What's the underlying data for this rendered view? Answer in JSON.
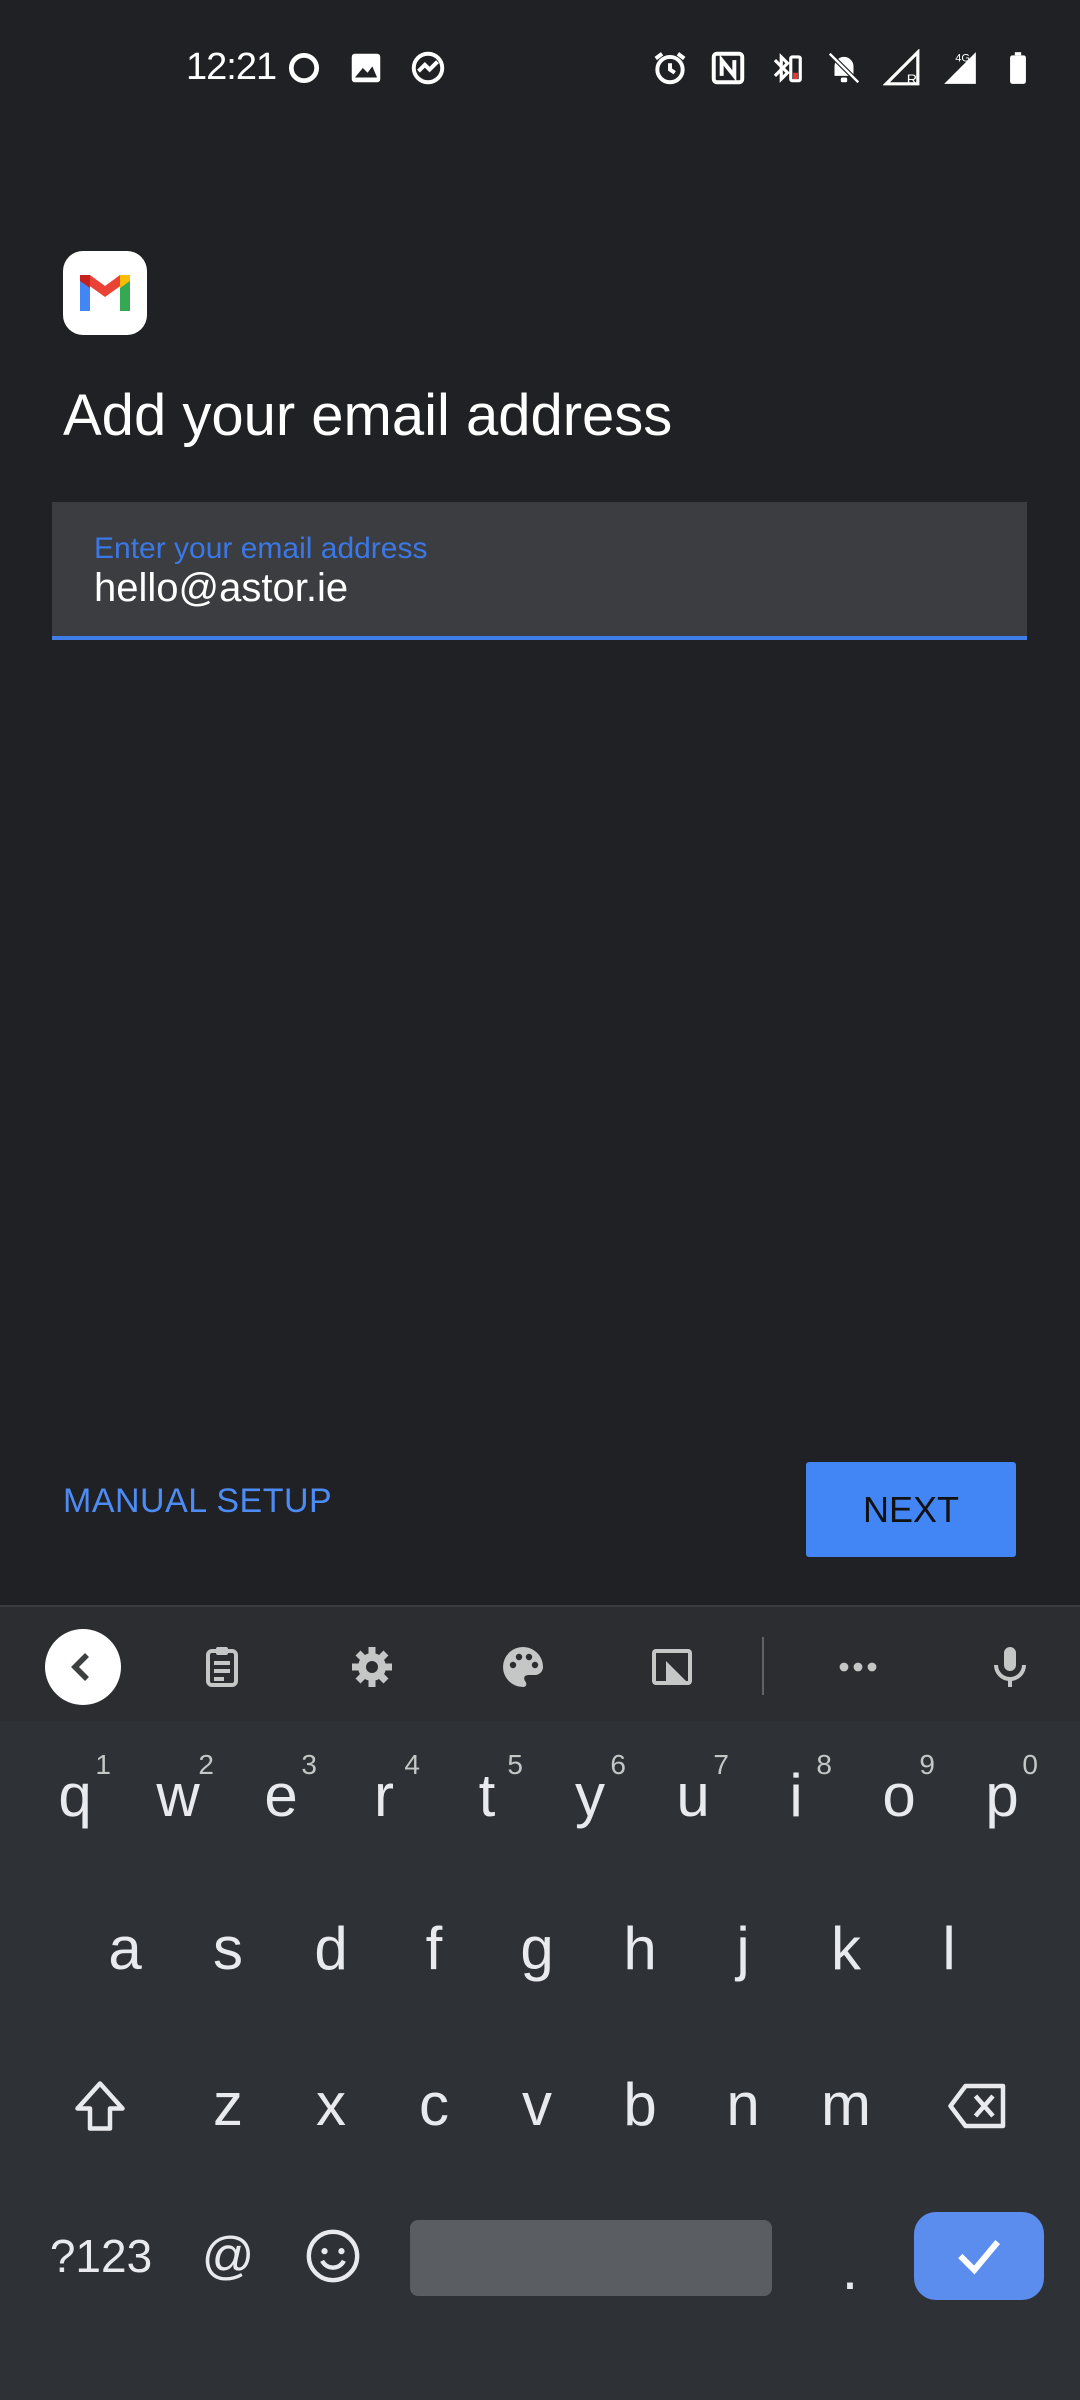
{
  "status_bar": {
    "time": "12:21",
    "left_icons": [
      "circle-status-icon",
      "image-icon",
      "chart-activity-icon"
    ],
    "right_icons": [
      "alarm-icon",
      "nfc-icon",
      "bluetooth-battery-icon",
      "bell-off-icon",
      "signal-r-icon",
      "signal-4g-icon",
      "battery-icon"
    ],
    "network_label": "4G"
  },
  "app": {
    "logo_icon": "gmail-icon",
    "title": "Add your email address",
    "email_field": {
      "label": "Enter your email address",
      "value": "hello@astor.ie"
    },
    "manual_setup_label": "MANUAL SETUP",
    "next_label": "NEXT",
    "accent_color": "#4285f4"
  },
  "keyboard": {
    "toolbar": [
      "back-icon",
      "clipboard-icon",
      "gear-icon",
      "palette-icon",
      "resize-icon",
      "more-icon",
      "mic-icon"
    ],
    "row1": [
      {
        "k": "q",
        "h": "1"
      },
      {
        "k": "w",
        "h": "2"
      },
      {
        "k": "e",
        "h": "3"
      },
      {
        "k": "r",
        "h": "4"
      },
      {
        "k": "t",
        "h": "5"
      },
      {
        "k": "y",
        "h": "6"
      },
      {
        "k": "u",
        "h": "7"
      },
      {
        "k": "i",
        "h": "8"
      },
      {
        "k": "o",
        "h": "9"
      },
      {
        "k": "p",
        "h": "0"
      }
    ],
    "row2": [
      "a",
      "s",
      "d",
      "f",
      "g",
      "h",
      "j",
      "k",
      "l"
    ],
    "row3": [
      "z",
      "x",
      "c",
      "v",
      "b",
      "n",
      "m"
    ],
    "symbols_label": "?123",
    "at_label": "@",
    "period_label": "."
  }
}
